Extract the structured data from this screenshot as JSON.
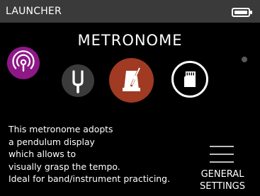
{
  "statusbar": {
    "title": "LAUNCHER",
    "battery_icon": "battery-full-icon"
  },
  "app_title": "METRONOME",
  "apps": [
    {
      "name": "Wireless",
      "icon": "wireless-broadcast-icon",
      "color": "#8e1887"
    },
    {
      "name": "Tuner",
      "icon": "tuning-fork-icon",
      "color": "#3b3b3b"
    },
    {
      "name": "Metronome",
      "icon": "metronome-icon",
      "color": "#a03a22",
      "selected": true
    },
    {
      "name": "SD Card",
      "icon": "sd-card-icon",
      "color": "#000000"
    }
  ],
  "description": "This metronome adopts\na pendulum display\nwhich allows to\nvisually grasp the tempo.\nIdeal for band/instrument practicing.",
  "general_settings": {
    "icon": "menu-icon",
    "label_line1": "GENERAL",
    "label_line2": "SETTINGS"
  }
}
